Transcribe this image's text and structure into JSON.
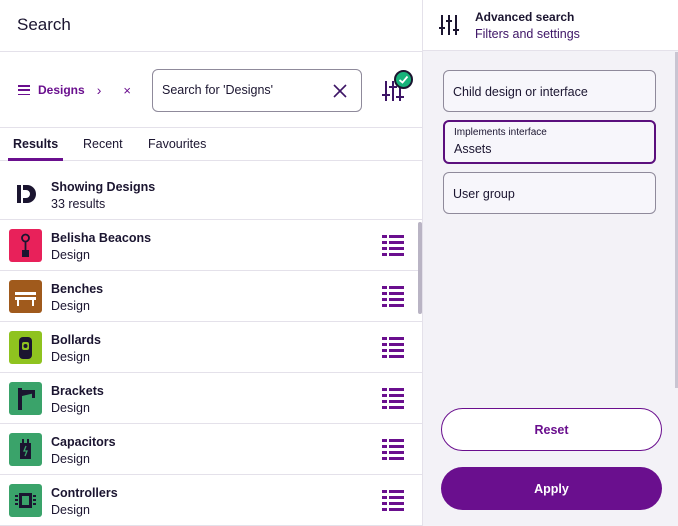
{
  "header": {
    "title": "Search"
  },
  "filter_chip": {
    "label": "Designs",
    "chevron": "›",
    "remove": "×"
  },
  "search": {
    "placeholder": "Search for 'Designs'"
  },
  "tabs": [
    {
      "label": "Results",
      "active": true
    },
    {
      "label": "Recent",
      "active": false
    },
    {
      "label": "Favourites",
      "active": false
    }
  ],
  "summary": {
    "title": "Showing Designs",
    "count": "33 results"
  },
  "results": [
    {
      "name": "Belisha Beacons",
      "kind": "Design",
      "color": "#e8215a",
      "icon": "beacon-icon"
    },
    {
      "name": "Benches",
      "kind": "Design",
      "color": "#a05a1c",
      "icon": "bench-icon"
    },
    {
      "name": "Bollards",
      "kind": "Design",
      "color": "#8fc31f",
      "icon": "bollard-icon"
    },
    {
      "name": "Brackets",
      "kind": "Design",
      "color": "#3aa36a",
      "icon": "bracket-icon"
    },
    {
      "name": "Capacitors",
      "kind": "Design",
      "color": "#3aa36a",
      "icon": "capacitor-icon"
    },
    {
      "name": "Controllers",
      "kind": "Design",
      "color": "#3aa36a",
      "icon": "chip-icon"
    }
  ],
  "advanced": {
    "title": "Advanced search",
    "subtitle": "Filters and settings",
    "fields": {
      "child": "Child design or interface",
      "implements_label": "Implements interface",
      "implements_value": "Assets",
      "user_group": "User group"
    },
    "reset_label": "Reset",
    "apply_label": "Apply"
  },
  "colors": {
    "accent": "#6a0f8e",
    "success": "#16b27a",
    "text": "#1b1530"
  }
}
